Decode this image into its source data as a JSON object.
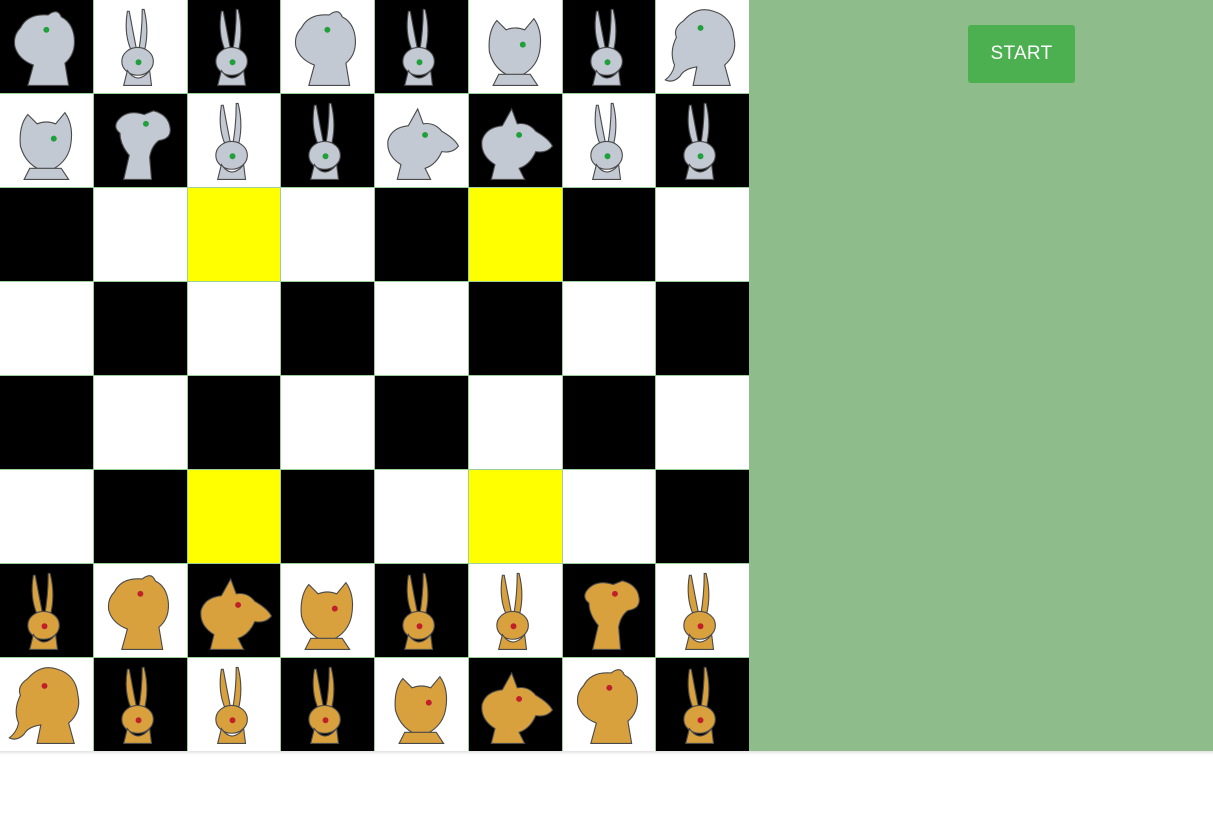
{
  "controls": {
    "start_label": "START"
  },
  "colors": {
    "panel": "#8fbc8b",
    "light_square": "#ffffff",
    "dark_square": "#000000",
    "highlight_square": "#ffff00",
    "start_button": "#4caf50",
    "silver_piece": "#c3c9d3",
    "gold_piece": "#d9a13e",
    "silver_eye": "#1fa03a",
    "gold_eye": "#c0202a"
  },
  "highlighted_squares": [
    [
      2,
      2
    ],
    [
      2,
      5
    ],
    [
      5,
      2
    ],
    [
      5,
      5
    ]
  ],
  "board": [
    [
      {
        "color": "black",
        "piece": {
          "side": "silver",
          "kind": "horse"
        }
      },
      {
        "color": "white",
        "piece": {
          "side": "silver",
          "kind": "rabbit"
        }
      },
      {
        "color": "black",
        "piece": {
          "side": "silver",
          "kind": "rabbit"
        }
      },
      {
        "color": "white",
        "piece": {
          "side": "silver",
          "kind": "horse"
        }
      },
      {
        "color": "black",
        "piece": {
          "side": "silver",
          "kind": "rabbit"
        }
      },
      {
        "color": "white",
        "piece": {
          "side": "silver",
          "kind": "cat"
        }
      },
      {
        "color": "black",
        "piece": {
          "side": "silver",
          "kind": "rabbit"
        }
      },
      {
        "color": "white",
        "piece": {
          "side": "silver",
          "kind": "elephant"
        }
      }
    ],
    [
      {
        "color": "white",
        "piece": {
          "side": "silver",
          "kind": "cat"
        }
      },
      {
        "color": "black",
        "piece": {
          "side": "silver",
          "kind": "camel"
        }
      },
      {
        "color": "white",
        "piece": {
          "side": "silver",
          "kind": "rabbit"
        }
      },
      {
        "color": "black",
        "piece": {
          "side": "silver",
          "kind": "rabbit"
        }
      },
      {
        "color": "white",
        "piece": {
          "side": "silver",
          "kind": "dog"
        }
      },
      {
        "color": "black",
        "piece": {
          "side": "silver",
          "kind": "dog"
        }
      },
      {
        "color": "white",
        "piece": {
          "side": "silver",
          "kind": "rabbit"
        }
      },
      {
        "color": "black",
        "piece": {
          "side": "silver",
          "kind": "rabbit"
        }
      }
    ],
    [
      {
        "color": "black",
        "piece": null
      },
      {
        "color": "white",
        "piece": null
      },
      {
        "color": "yellow",
        "piece": null
      },
      {
        "color": "white",
        "piece": null
      },
      {
        "color": "black",
        "piece": null
      },
      {
        "color": "yellow",
        "piece": null
      },
      {
        "color": "black",
        "piece": null
      },
      {
        "color": "white",
        "piece": null
      }
    ],
    [
      {
        "color": "white",
        "piece": null
      },
      {
        "color": "black",
        "piece": null
      },
      {
        "color": "white",
        "piece": null
      },
      {
        "color": "black",
        "piece": null
      },
      {
        "color": "white",
        "piece": null
      },
      {
        "color": "black",
        "piece": null
      },
      {
        "color": "white",
        "piece": null
      },
      {
        "color": "black",
        "piece": null
      }
    ],
    [
      {
        "color": "black",
        "piece": null
      },
      {
        "color": "white",
        "piece": null
      },
      {
        "color": "black",
        "piece": null
      },
      {
        "color": "white",
        "piece": null
      },
      {
        "color": "black",
        "piece": null
      },
      {
        "color": "white",
        "piece": null
      },
      {
        "color": "black",
        "piece": null
      },
      {
        "color": "white",
        "piece": null
      }
    ],
    [
      {
        "color": "white",
        "piece": null
      },
      {
        "color": "black",
        "piece": null
      },
      {
        "color": "yellow",
        "piece": null
      },
      {
        "color": "black",
        "piece": null
      },
      {
        "color": "white",
        "piece": null
      },
      {
        "color": "yellow",
        "piece": null
      },
      {
        "color": "white",
        "piece": null
      },
      {
        "color": "black",
        "piece": null
      }
    ],
    [
      {
        "color": "black",
        "piece": {
          "side": "gold",
          "kind": "rabbit"
        }
      },
      {
        "color": "white",
        "piece": {
          "side": "gold",
          "kind": "horse"
        }
      },
      {
        "color": "black",
        "piece": {
          "side": "gold",
          "kind": "dog"
        }
      },
      {
        "color": "white",
        "piece": {
          "side": "gold",
          "kind": "cat"
        }
      },
      {
        "color": "black",
        "piece": {
          "side": "gold",
          "kind": "rabbit"
        }
      },
      {
        "color": "white",
        "piece": {
          "side": "gold",
          "kind": "rabbit"
        }
      },
      {
        "color": "black",
        "piece": {
          "side": "gold",
          "kind": "camel"
        }
      },
      {
        "color": "white",
        "piece": {
          "side": "gold",
          "kind": "rabbit"
        }
      }
    ],
    [
      {
        "color": "white",
        "piece": {
          "side": "gold",
          "kind": "elephant"
        }
      },
      {
        "color": "black",
        "piece": {
          "side": "gold",
          "kind": "rabbit"
        }
      },
      {
        "color": "white",
        "piece": {
          "side": "gold",
          "kind": "rabbit"
        }
      },
      {
        "color": "black",
        "piece": {
          "side": "gold",
          "kind": "rabbit"
        }
      },
      {
        "color": "white",
        "piece": {
          "side": "gold",
          "kind": "cat"
        }
      },
      {
        "color": "black",
        "piece": {
          "side": "gold",
          "kind": "dog"
        }
      },
      {
        "color": "white",
        "piece": {
          "side": "gold",
          "kind": "horse"
        }
      },
      {
        "color": "black",
        "piece": {
          "side": "gold",
          "kind": "rabbit"
        }
      }
    ]
  ]
}
